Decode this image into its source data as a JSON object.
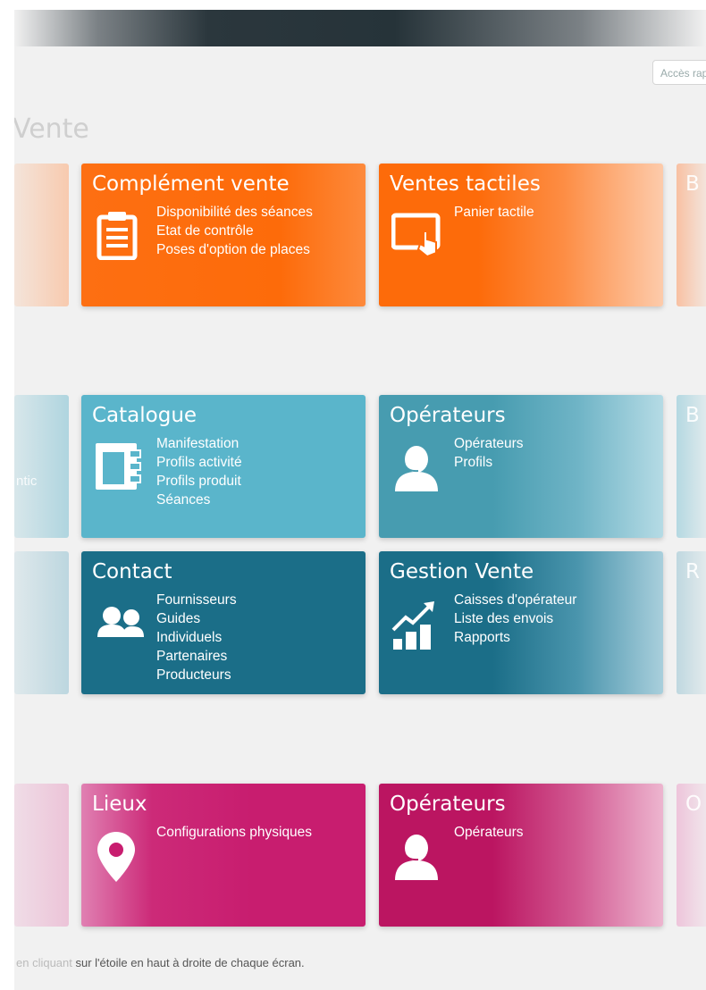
{
  "header": {
    "quick_access_label": "Accès rapide"
  },
  "section_heading": "Vente",
  "tiles": {
    "complement": {
      "title": "Complément vente",
      "items": [
        "Disponibilité des séances",
        "Etat de contrôle",
        "Poses d'option de places"
      ],
      "icon": "clipboard-icon"
    },
    "tactiles": {
      "title": "Ventes tactiles",
      "items": [
        "Panier tactile"
      ],
      "icon": "touch-screen-icon"
    },
    "catalogue": {
      "title": "Catalogue",
      "items": [
        "Manifestation",
        "Profils activité",
        "Profils produit",
        "Séances"
      ],
      "icon": "catalog-icon"
    },
    "operateurs1": {
      "title": "Opérateurs",
      "items": [
        "Opérateurs",
        "Profils"
      ],
      "icon": "operator-headset-icon"
    },
    "contact": {
      "title": "Contact",
      "items": [
        "Fournisseurs",
        "Guides",
        "Individuels",
        "Partenaires",
        "Producteurs"
      ],
      "icon": "users-icon"
    },
    "gestion": {
      "title": "Gestion Vente",
      "items": [
        "Caisses d'opérateur",
        "Liste des envois",
        "Rapports"
      ],
      "icon": "growth-chart-icon"
    },
    "lieux": {
      "title": "Lieux",
      "items": [
        "Configurations physiques"
      ],
      "icon": "map-pin-icon"
    },
    "operateurs2": {
      "title": "Opérateurs",
      "items": [
        "Opérateurs"
      ],
      "icon": "operator-headset-icon"
    }
  },
  "partial_tiles": {
    "right_row1_title": "B",
    "right_row2_title": "B",
    "right_row3_title": "R",
    "right_row4_title": "O",
    "left_row2_text": "ntic"
  },
  "footer": {
    "text_faded": "en cliquant ",
    "text": "sur l'étoile en haut à droite de chaque écran."
  },
  "colors": {
    "orange": "#fd6b0a",
    "light_blue": "#5ab5cb",
    "mid_blue": "#479cb0",
    "dark_blue": "#1b6e88",
    "magenta": "#c81d6f",
    "deep_magenta": "#bb1561"
  }
}
